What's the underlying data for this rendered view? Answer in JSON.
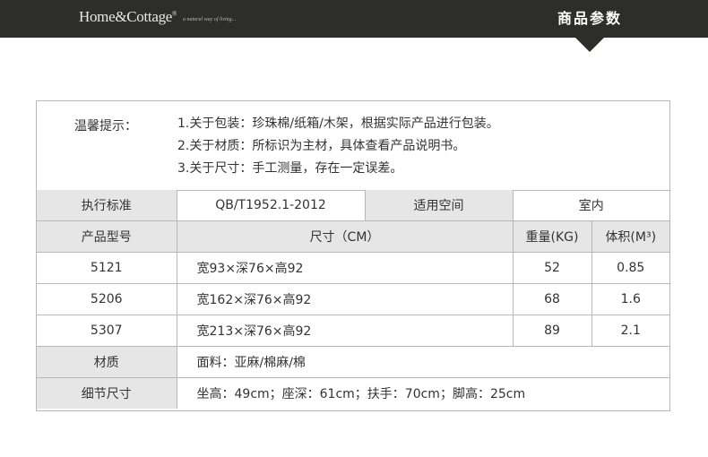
{
  "header": {
    "brand": "Home&Cottage",
    "brand_mark": "®",
    "tagline": "a natural way of living...",
    "title": "商品参数"
  },
  "notice": {
    "label": "温馨提示：",
    "lines": [
      "1.关于包装：珍珠棉/纸箱/木架，根据实际产品进行包装。",
      "2.关于材质：所标识为主材，具体查看产品说明书。",
      "3.关于尺寸：手工测量，存在一定误差。"
    ]
  },
  "specs": {
    "standard_label": "执行标准",
    "standard_value": "QB/T1952.1-2012",
    "space_label": "适用空间",
    "space_value": "室内",
    "headers": {
      "model": "产品型号",
      "size": "尺寸（CM）",
      "weight": "重量(KG)",
      "volume": "体积(M³)"
    },
    "rows": [
      {
        "model": "5121",
        "size": "宽93×深76×高92",
        "weight": "52",
        "volume": "0.85"
      },
      {
        "model": "5206",
        "size": "宽162×深76×高92",
        "weight": "68",
        "volume": "1.6"
      },
      {
        "model": "5307",
        "size": "宽213×深76×高92",
        "weight": "89",
        "volume": "2.1"
      }
    ],
    "material_label": "材质",
    "material_value": "面料：亚麻/棉麻/棉",
    "detail_label": "细节尺寸",
    "detail_value": "坐高：49cm；座深：61cm；扶手：70cm；脚高：25cm"
  }
}
